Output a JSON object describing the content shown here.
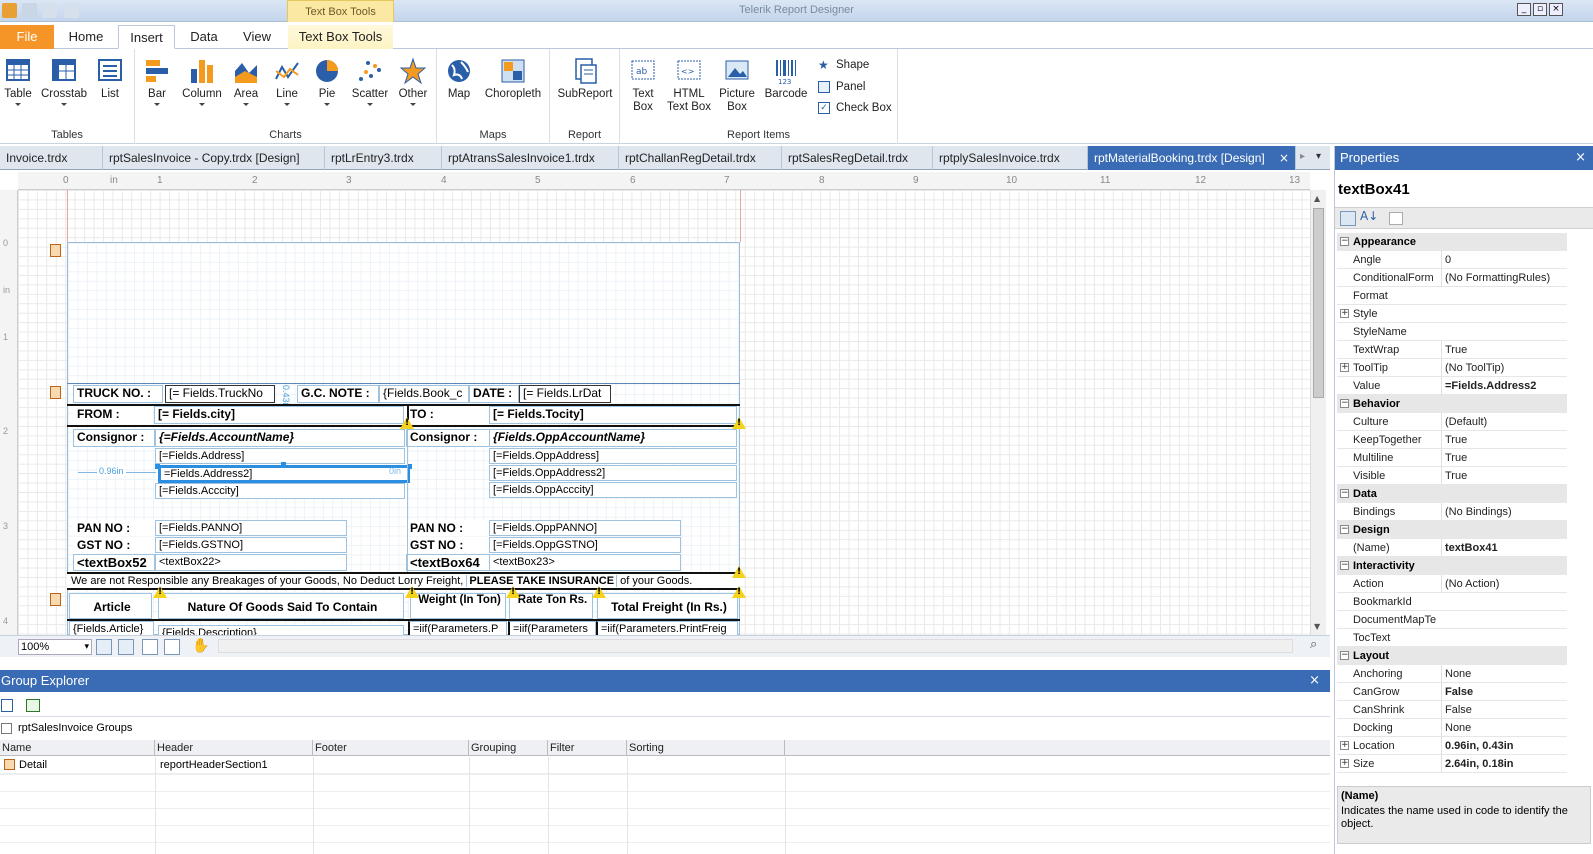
{
  "window": {
    "title": "Telerik Report Designer",
    "contextual_tab": "Text Box Tools"
  },
  "ribbon_tabs": [
    "File",
    "Home",
    "Insert",
    "Data",
    "View",
    "Text Box Tools"
  ],
  "ribbon": {
    "tables": {
      "label": "Tables",
      "items": [
        "Table",
        "Crosstab",
        "List"
      ]
    },
    "charts": {
      "label": "Charts",
      "items": [
        "Bar",
        "Column",
        "Area",
        "Line",
        "Pie",
        "Scatter",
        "Other"
      ]
    },
    "maps": {
      "label": "Maps",
      "items": [
        "Map",
        "Choropleth"
      ]
    },
    "report": {
      "label": "Report",
      "items": [
        "SubReport"
      ]
    },
    "report_items": {
      "label": "Report Items",
      "items": [
        "Text Box",
        "HTML Text Box",
        "Picture Box",
        "Barcode"
      ],
      "small": [
        "Shape",
        "Panel",
        "Check Box"
      ]
    }
  },
  "doc_tabs": [
    "Invoice.trdx",
    "rptSalesInvoice - Copy.trdx [Design]",
    "rptLrEntry3.trdx",
    "rptAtransSalesInvoice1.trdx",
    "rptChallanRegDetail.trdx",
    "rptSalesRegDetail.trdx",
    "rptplySalesInvoice.trdx",
    "rptMaterialBooking.trdx [Design]"
  ],
  "ruler": {
    "unit": "in",
    "h": [
      "0",
      "1",
      "2",
      "3",
      "4",
      "5",
      "6",
      "7",
      "8",
      "9",
      "10",
      "11",
      "12",
      "13"
    ],
    "v": [
      "0",
      "1",
      "2",
      "3",
      "4"
    ]
  },
  "report": {
    "truck_label": "TRUCK NO. :",
    "truck_field": "[= Fields.TruckNo",
    "gc_label": "G.C. NOTE :",
    "gc_field": "{Fields.Book_c",
    "date_label": "DATE :",
    "date_field": "[= Fields.LrDat",
    "height_badge": "0.43in",
    "from_label": "FROM :",
    "from_field": "[= Fields.city]",
    "to_label": "TO :",
    "to_field": "[= Fields.Tocity]",
    "consignor_label": "Consignor :",
    "consignor_field": "{=Fields.AccountName}",
    "consignor2_label": "Consignor :",
    "consignor2_field": "{Fields.OppAccountName}",
    "addr1": "[=Fields.Address]",
    "addr2": "=Fields.Address2]",
    "addr3": "[=Fields.Acccity]",
    "oaddr1": "[=Fields.OppAddress]",
    "oaddr2": "[=Fields.OppAddress2]",
    "oaddr3": "[=Fields.OppAcccity]",
    "width_badge": "0.96in",
    "zero_badge": "0in",
    "pan_label": "PAN NO :",
    "pan_field": "[=Fields.PANNO]",
    "gst_label": "GST NO :",
    "gst_field": "[=Fields.GSTNO]",
    "tb52": "<textBox52",
    "tb22": "<textBox22>",
    "pan2_label": "PAN NO :",
    "pan2_field": "[=Fields.OppPANNO]",
    "gst2_label": "GST NO :",
    "gst2_field": "[=Fields.OppGSTNO]",
    "tb64": "<textBox64",
    "tb23": "<textBox23>",
    "notice_a": "We are not Responsible any Breakages of your Goods, No Deduct Lorry Freight,",
    "notice_b": "PLEASE TAKE INSURANCE",
    "notice_c": "of your Goods.",
    "col_article": "Article",
    "col_nature": "Nature Of Goods Said To Contain",
    "col_weight": "Weight (In Ton)",
    "col_rate": "Rate Ton Rs.",
    "col_freight": "Total Freight (In Rs.)",
    "row_article": "{Fields.Article}",
    "row_desc": "{Fields.Description}",
    "row_w": "=iif(Parameters.P",
    "row_r": "=iif(Parameters",
    "row_f": "=iif(Parameters.PrintFreig"
  },
  "zoom": "100%",
  "group_explorer": {
    "title": "Group Explorer",
    "root": "rptSalesInvoice Groups",
    "columns": [
      "Name",
      "Header",
      "Footer",
      "Grouping",
      "Filter",
      "Sorting"
    ],
    "rows": [
      {
        "name": "Detail",
        "header": "reportHeaderSection1",
        "footer": "",
        "grouping": "",
        "filter": "",
        "sorting": ""
      }
    ]
  },
  "properties": {
    "title": "Properties",
    "object": "textBox41",
    "sections": [
      {
        "name": "Appearance",
        "rows": [
          [
            "Angle",
            "0"
          ],
          [
            "ConditionalForm",
            "(No FormattingRules)"
          ],
          [
            "Format",
            ""
          ],
          [
            "Style",
            ""
          ],
          [
            "StyleName",
            ""
          ],
          [
            "TextWrap",
            "True"
          ],
          [
            "ToolTip",
            "(No ToolTip)"
          ],
          [
            "Value",
            "=Fields.Address2"
          ]
        ]
      },
      {
        "name": "Behavior",
        "rows": [
          [
            "Culture",
            "(Default)"
          ],
          [
            "KeepTogether",
            "True"
          ],
          [
            "Multiline",
            "True"
          ],
          [
            "Visible",
            "True"
          ]
        ]
      },
      {
        "name": "Data",
        "rows": [
          [
            "Bindings",
            "(No Bindings)"
          ]
        ]
      },
      {
        "name": "Design",
        "rows": [
          [
            "(Name)",
            "textBox41"
          ]
        ]
      },
      {
        "name": "Interactivity",
        "rows": [
          [
            "Action",
            "(No Action)"
          ],
          [
            "BookmarkId",
            ""
          ],
          [
            "DocumentMapTe",
            ""
          ],
          [
            "TocText",
            ""
          ]
        ]
      },
      {
        "name": "Layout",
        "rows": [
          [
            "Anchoring",
            "None"
          ],
          [
            "CanGrow",
            "False"
          ],
          [
            "CanShrink",
            "False"
          ],
          [
            "Docking",
            "None"
          ],
          [
            "Location",
            "0.96in, 0.43in"
          ],
          [
            "Size",
            "2.64in, 0.18in"
          ]
        ]
      }
    ],
    "help_title": "(Name)",
    "help_text": "Indicates the name used in code to identify the object."
  },
  "colors": {
    "accent": "#3a6cb5",
    "file_tab": "#f59427",
    "warning": "#f4d31a",
    "selection": "#2c8ee0"
  }
}
